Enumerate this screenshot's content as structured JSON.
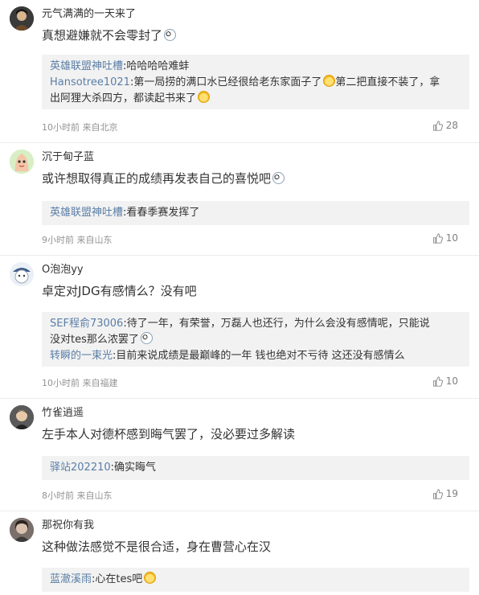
{
  "comments": [
    {
      "username": "元气满满的一天来了",
      "content": "真想避嫌就不会零封了",
      "emoji": "emoji-face",
      "replies": [
        {
          "name": "英雄联盟神吐槽",
          "text": ":哈哈哈哈难蚌"
        },
        {
          "name": "Hansotree1021",
          "text": ":第一局捞的满口水已经很给老东家面子了",
          "text2": "第二把直接不装了，拿",
          "text3": "出阿狸大杀四方，都读起书来了"
        }
      ],
      "meta": "10小时前 来自北京",
      "likes": "28"
    },
    {
      "username": "沉于甸子蓝",
      "content": "或许想取得真正的成绩再发表自己的喜悦吧",
      "emoji": "emoji-face",
      "replies": [
        {
          "name": "英雄联盟神吐槽",
          "text": ":看春季赛发挥了"
        }
      ],
      "meta": "9小时前 来自山东",
      "likes": "10"
    },
    {
      "username": "O泡泡yy",
      "content": "卓定对JDG有感情么？没有吧",
      "replies": [
        {
          "name": "SEF程俞73006",
          "text": ":待了一年，有荣誉，万磊人也还行，为什么会没有感情呢，只能说",
          "text2": "没对tes那么浓罢了"
        },
        {
          "name": "转瞬的一束光",
          "text": ":目前来说成绩是最巅峰的一年 钱也绝对不亏待 这还没有感情么"
        }
      ],
      "meta": "10小时前 来自福建",
      "likes": "10"
    },
    {
      "username": "竹雀逍遥",
      "content": "左手本人对德杯感到晦气罢了，没必要过多解读",
      "replies": [
        {
          "name": "驿站202210",
          "text": ":确实晦气"
        }
      ],
      "meta": "8小时前 来自山东",
      "likes": "19"
    },
    {
      "username": "那祝你有我",
      "content": "这种做法感觉不是很合适，身在曹营心在汉",
      "replies": [
        {
          "name": "蓝澈溪雨",
          "text": ":心在tes吧"
        }
      ],
      "meta": "",
      "likes": ""
    }
  ],
  "colors": {
    "username_link": "#5a7ea6",
    "meta_gray": "#939393",
    "reply_bg": "#f2f2f2"
  },
  "icons": {
    "like": "thumbs-up-icon"
  }
}
